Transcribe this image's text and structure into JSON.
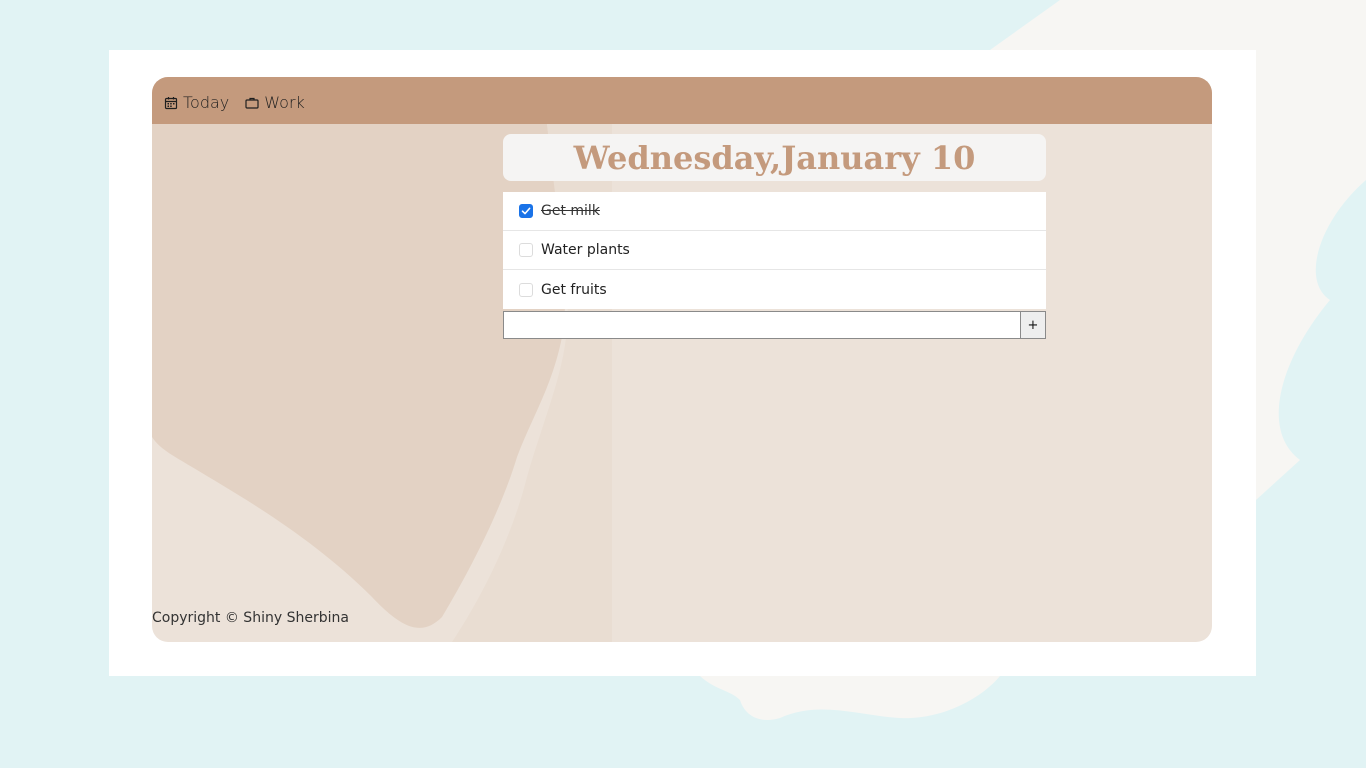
{
  "nav": {
    "items": [
      {
        "label": "Today",
        "icon": "calendar-icon"
      },
      {
        "label": "Work",
        "icon": "briefcase-icon"
      }
    ]
  },
  "header": {
    "date_title": "Wednesday,January 10"
  },
  "todos": [
    {
      "label": "Get milk",
      "checked": true
    },
    {
      "label": "Water plants",
      "checked": false
    },
    {
      "label": "Get fruits",
      "checked": false
    }
  ],
  "add_form": {
    "input_value": "",
    "button_label": "+"
  },
  "footer": {
    "copyright": "Copyright © Shiny Sherbina"
  },
  "colors": {
    "page_bg": "#e1f3f4",
    "nav_bg": "#c49a7d",
    "accent": "#c49a7d",
    "panel_bg": "#ece2d9",
    "checkbox_checked": "#1a73e8"
  }
}
